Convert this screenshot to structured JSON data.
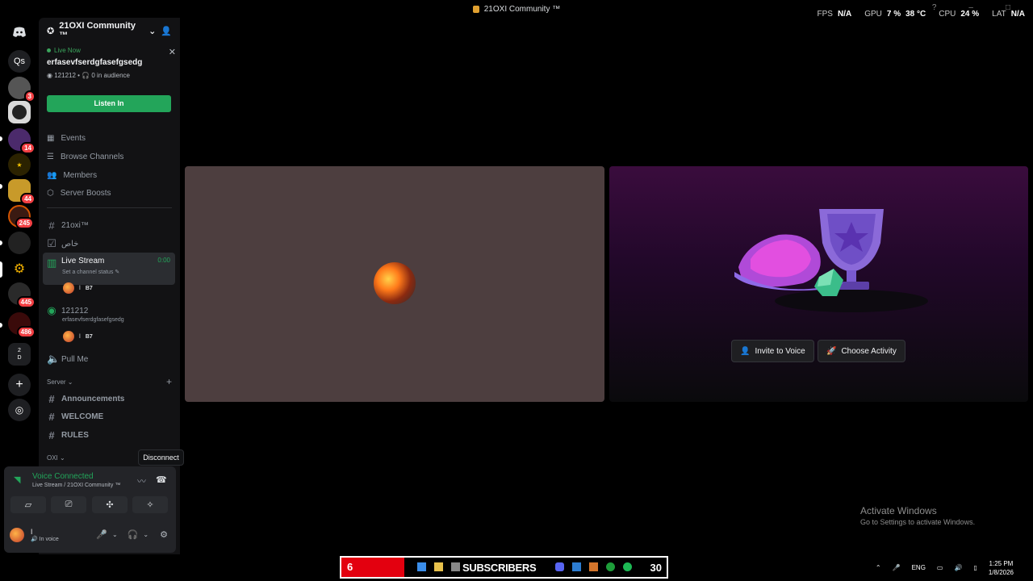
{
  "window": {
    "title": "21OXI Community ™"
  },
  "overlay": {
    "fps_label": "FPS",
    "fps_value": "N/A",
    "gpu_label": "GPU",
    "gpu_value": "7 %",
    "gpu_temp": "38 °C",
    "cpu_label": "CPU",
    "cpu_value": "24 %",
    "lat_label": "LAT",
    "lat_value": "N/A"
  },
  "rail": {
    "dm_label": "Qs",
    "badges": [
      "3",
      "14",
      "44",
      "245",
      "445",
      "486"
    ],
    "folder_text": "2\nD"
  },
  "server": {
    "name": "21OXI Community ™",
    "live": {
      "status": "Live Now",
      "title": "erfasevfserdgfasefgsedg",
      "channel": "121212",
      "audience": "0 in audience",
      "listen_label": "Listen In"
    },
    "nav": [
      {
        "label": "Events"
      },
      {
        "label": "Browse Channels"
      },
      {
        "label": "Members"
      },
      {
        "label": "Server Boosts"
      }
    ],
    "channels": {
      "c1": "21oxi™",
      "c2": "خاص",
      "live_stream": "Live Stream",
      "live_stream_timer": "0:00",
      "live_stream_status": "Set a channel status",
      "user_tag": "B7",
      "stage": "121212",
      "stage_topic": "erfasevfserdgfasefgsedg",
      "pull_me": "Pull Me",
      "server_category": "Server",
      "announcements": "Announcements",
      "welcome": "WELCOME",
      "rules": "RULES",
      "oxi_category": "OXI"
    }
  },
  "tooltip": {
    "disconnect": "Disconnect"
  },
  "voice": {
    "status": "Voice Connected",
    "location": "Live Stream / 21OXI Community ™",
    "user_status": "In voice"
  },
  "activity": {
    "invite_label": "Invite to Voice",
    "choose_label": "Choose Activity"
  },
  "watermark": {
    "line1": "Activate Windows",
    "line2": "Go to Settings to activate Windows."
  },
  "taskbar": {
    "subs_count": "6",
    "subs_label": "SUBSCRIBERS",
    "subs_goal": "30",
    "lang": "ENG",
    "time": "1:25 PM",
    "date": "1/8/2026"
  },
  "colors": {
    "accent_green": "#23a55a",
    "badge_red": "#f23f43",
    "tile_brown": "#4d3e3f"
  }
}
